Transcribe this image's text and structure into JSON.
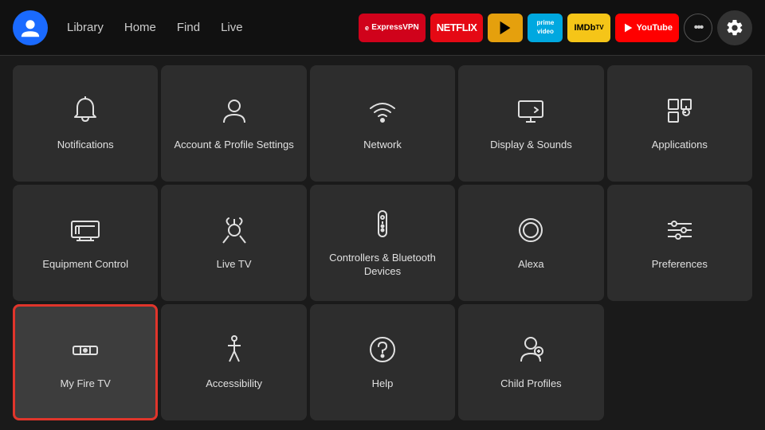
{
  "nav": {
    "links": [
      "Library",
      "Home",
      "Find",
      "Live"
    ],
    "apps": [
      {
        "name": "ExpressVPN",
        "class": "app-expressvpn",
        "label": "ExpressVPN"
      },
      {
        "name": "Netflix",
        "class": "app-netflix",
        "label": "NETFLIX"
      },
      {
        "name": "Plex",
        "class": "app-plex",
        "label": "▶"
      },
      {
        "name": "Prime Video",
        "class": "app-prime",
        "label": "prime\nvideo"
      },
      {
        "name": "IMDb TV",
        "class": "app-imdb",
        "label": "IMDbᴛᴠ"
      },
      {
        "name": "YouTube",
        "class": "app-youtube",
        "label": "▶ YouTube"
      }
    ]
  },
  "grid": {
    "items": [
      {
        "id": "notifications",
        "label": "Notifications",
        "icon": "bell"
      },
      {
        "id": "account-profile",
        "label": "Account & Profile Settings",
        "icon": "person"
      },
      {
        "id": "network",
        "label": "Network",
        "icon": "wifi"
      },
      {
        "id": "display-sounds",
        "label": "Display & Sounds",
        "icon": "display"
      },
      {
        "id": "applications",
        "label": "Applications",
        "icon": "apps"
      },
      {
        "id": "equipment-control",
        "label": "Equipment Control",
        "icon": "tv"
      },
      {
        "id": "live-tv",
        "label": "Live TV",
        "icon": "antenna"
      },
      {
        "id": "controllers-bluetooth",
        "label": "Controllers & Bluetooth Devices",
        "icon": "remote"
      },
      {
        "id": "alexa",
        "label": "Alexa",
        "icon": "alexa"
      },
      {
        "id": "preferences",
        "label": "Preferences",
        "icon": "sliders"
      },
      {
        "id": "my-fire-tv",
        "label": "My Fire TV",
        "icon": "firetv",
        "focused": true
      },
      {
        "id": "accessibility",
        "label": "Accessibility",
        "icon": "accessibility"
      },
      {
        "id": "help",
        "label": "Help",
        "icon": "help"
      },
      {
        "id": "child-profiles",
        "label": "Child Profiles",
        "icon": "child"
      },
      {
        "id": "empty",
        "label": "",
        "icon": "none"
      }
    ]
  }
}
